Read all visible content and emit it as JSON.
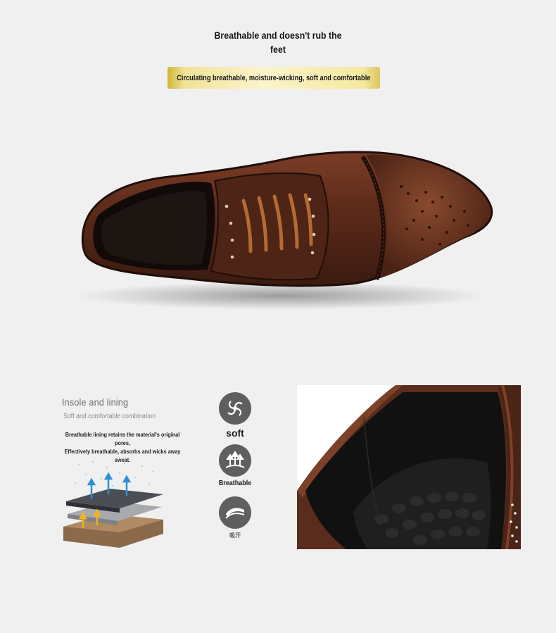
{
  "header": {
    "headline_line1": "Breathable and doesn't rub the",
    "headline_line2": "feet",
    "banner_text": "Circulating breathable, moisture-wicking, soft and comfortable"
  },
  "insole": {
    "title": "Insole and lining",
    "subtitle": "Soft and comfortable combination",
    "desc_line1": "Breathable lining retains the material's original pores,",
    "desc_line2": "Effectively breathable, absorbs and wicks away",
    "desc_line3": "sweat."
  },
  "features": [
    {
      "label": "soft",
      "icon": "swirl-icon"
    },
    {
      "label": "Breathable",
      "icon": "arrows-up-icon"
    },
    {
      "label": "吸汗",
      "icon": "wave-icon"
    }
  ],
  "colors": {
    "background": "#f0f0f0",
    "banner_gold": "#e8d77a",
    "leather_brown": "#5a2c1c",
    "icon_gray": "#5f5f5f",
    "lace_tan": "#b36b33"
  }
}
